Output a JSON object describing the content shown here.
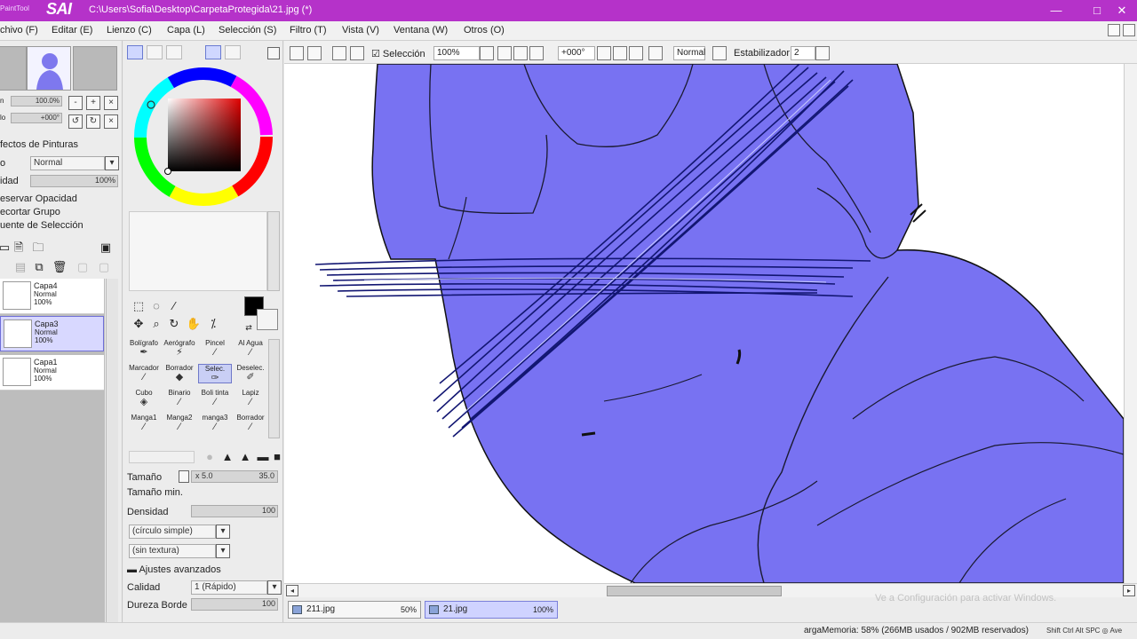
{
  "colors": {
    "title_bar": "#b532c9",
    "figure_fill": "#7872f2",
    "stroke_scribble": "#121672",
    "selected_tool": "#c9cff5"
  },
  "titlebar": {
    "logo_small": "PaintTool",
    "logo_big": "SAI",
    "file_path": "C:\\Users\\Sofia\\Desktop\\CarpetaProtegida\\21.jpg (*)",
    "minimize_icon": "minimize-icon",
    "maximize_icon": "maximize-icon",
    "close_icon": "close-icon"
  },
  "menubar": {
    "items": [
      {
        "label": "chivo (F)"
      },
      {
        "label": "Editar (E)"
      },
      {
        "label": "Lienzo (C)"
      },
      {
        "label": "Capa (L)"
      },
      {
        "label": "Selección (S)"
      },
      {
        "label": "Filtro (T)"
      },
      {
        "label": "Vista (V)"
      },
      {
        "label": "Ventana (W)"
      },
      {
        "label": "Otros (O)"
      }
    ]
  },
  "navigator": {
    "zoom_value": "100.0%",
    "angle_value": "+000°",
    "zoom_label": "n",
    "angle_label": "lo"
  },
  "layer_props": {
    "effects_label": "fectos de Pinturas",
    "mode_label": "o",
    "mode_value": "Normal",
    "opacity_label": "idad",
    "opacity_value": "100%",
    "preserve_opacity": "eservar Opacidad",
    "clip_group": "ecortar Grupo",
    "selection_source": "uente de Selección"
  },
  "layers": [
    {
      "name": "Capa4",
      "mode": "Normal",
      "opacity": "100%",
      "selected": false
    },
    {
      "name": "Capa3",
      "mode": "Normal",
      "opacity": "100%",
      "selected": true
    },
    {
      "name": "Capa1",
      "mode": "Normal",
      "opacity": "100%",
      "selected": false
    }
  ],
  "tools": [
    {
      "name": "Bolígrafo",
      "icon": "pen-icon",
      "glyph": "✒"
    },
    {
      "name": "Aerógrafo",
      "icon": "airbrush-icon",
      "glyph": "✈"
    },
    {
      "name": "Pincel",
      "icon": "brush-icon",
      "glyph": "🖌"
    },
    {
      "name": "Al Agua",
      "icon": "water-brush-icon",
      "glyph": "✎"
    },
    {
      "name": "Marcador",
      "icon": "marker-icon",
      "glyph": "✎"
    },
    {
      "name": "Borrador",
      "icon": "eraser-icon",
      "glyph": "◧"
    },
    {
      "name": "Selec.",
      "icon": "select-pen-icon",
      "glyph": "✑",
      "selected": true
    },
    {
      "name": "Deselec.",
      "icon": "deselect-pen-icon",
      "glyph": "✐"
    },
    {
      "name": "Cubo",
      "icon": "bucket-icon",
      "glyph": "◈"
    },
    {
      "name": "Binario",
      "icon": "binary-pen-icon",
      "glyph": "✎"
    },
    {
      "name": "Boli tinta",
      "icon": "ink-pen-icon",
      "glyph": "✒"
    },
    {
      "name": "Lapiz",
      "icon": "pencil-icon",
      "glyph": "✏"
    },
    {
      "name": "Manga1",
      "icon": "manga-pen-icon",
      "glyph": "✒"
    },
    {
      "name": "Manga2",
      "icon": "manga-pen-icon",
      "glyph": "✒"
    },
    {
      "name": "manga3",
      "icon": "manga-pen-icon",
      "glyph": "✒"
    },
    {
      "name": "Borrador",
      "icon": "eraser-icon",
      "glyph": "✒"
    }
  ],
  "brush_settings": {
    "size_label": "Tamaño",
    "size_multiplier": "x 5.0",
    "size_value": "35.0",
    "min_size_label": "Tamaño min.",
    "density_label": "Densidad",
    "density_value": "100",
    "shape": "(círculo simple)",
    "texture": "(sin textura)",
    "advanced_label": "Ajustes avanzados",
    "quality_label": "Calidad",
    "quality_value": "1 (Rápido)",
    "edge_label": "Dureza Borde",
    "edge_value": "100"
  },
  "canvas_toolbar": {
    "selection_label": "Selección",
    "zoom_value": "100%",
    "angle_value": "+000°",
    "blend_value": "Normal",
    "stabilizer_label": "Estabilizador",
    "stabilizer_value": "2"
  },
  "doc_tabs": [
    {
      "name": "211.jpg",
      "zoom": "50%",
      "active": false
    },
    {
      "name": "21.jpg",
      "zoom": "100%",
      "active": true
    }
  ],
  "statusbar": {
    "memory": "argaMemoria: 58% (266MB usados / 902MB reservados)",
    "keys": "Shift Ctrl Alt SPC ◎ Ave",
    "watermark": "Ve a Configuración para activar Windows."
  }
}
